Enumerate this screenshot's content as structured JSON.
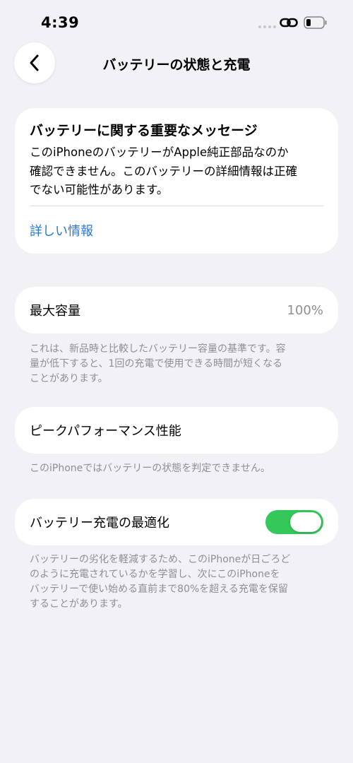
{
  "status_bar": {
    "time": "4:39",
    "signal_icon": "cellular-signal-icon",
    "link_icon": "personal-hotspot-link-icon",
    "battery_icon": "battery-icon"
  },
  "nav": {
    "back_icon": "chevron-left-icon",
    "title": "バッテリーの状態と充電"
  },
  "message_card": {
    "title": "バッテリーに関する重要なメッセージ",
    "body_lines": [
      "このiPhoneのバッテリーがApple純正部品なのか",
      "確認できません。このバッテリーの詳細情報は正確",
      "でない可能性があります。"
    ],
    "link": "詳しい情報"
  },
  "max_capacity": {
    "label": "最大容量",
    "value": "100%",
    "note_lines": [
      "これは、新品時と比較したバッテリー容量の基準です。容",
      "量が低下すると、1回の充電で使用できる時間が短くなる",
      "ことがあります。"
    ]
  },
  "peak_performance": {
    "label": "ピークパフォーマンス性能",
    "note": "このiPhoneではバッテリーの状態を判定できません。"
  },
  "optimized_charging": {
    "label": "バッテリー充電の最適化",
    "enabled": true,
    "note_lines": [
      "バッテリーの劣化を軽減するため、このiPhoneが日ごろど",
      "のように充電されているかを学習し、次にこのiPhoneを",
      "バッテリーで使い始める直前まで80%を超える充電を保留",
      "することがあります。"
    ]
  },
  "colors": {
    "background": "#f2f1f6",
    "link": "#2a77d8",
    "toggle_on": "#34c759",
    "secondary_text": "#8e8e93"
  }
}
